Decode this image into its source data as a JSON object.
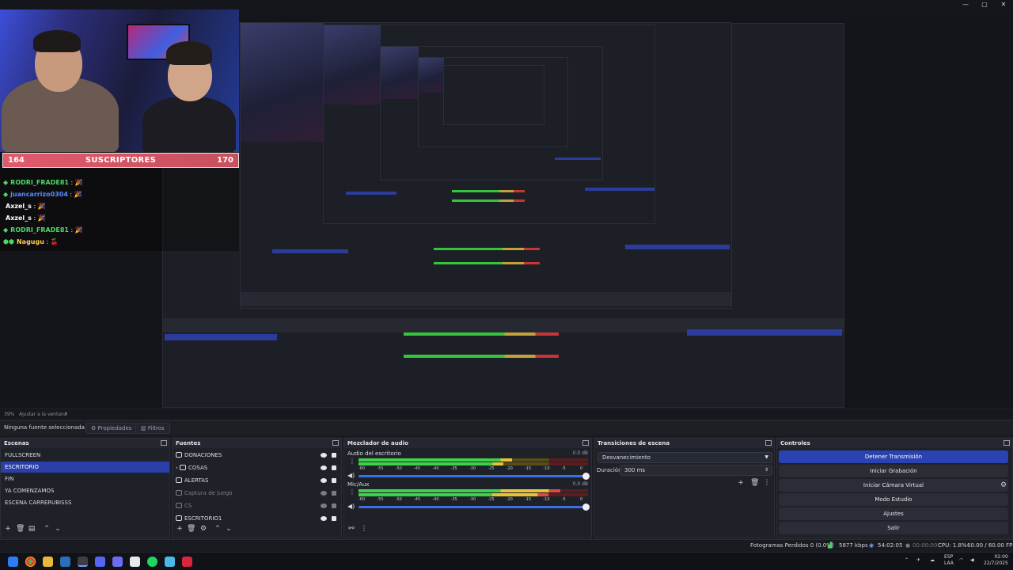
{
  "window": {
    "controls": [
      "—",
      "▢",
      "✕"
    ]
  },
  "overlay": {
    "sub_bar": {
      "current": "164",
      "label": "SUSCRIPTORES",
      "goal": "170"
    },
    "chat": [
      {
        "user": "RODRI_FRADE81",
        "msg": "🎉",
        "color": "#4cd964",
        "badge": "◆"
      },
      {
        "user": "juancarrizo0304",
        "msg": "🎉",
        "color": "#5a8cff",
        "badge": "◆"
      },
      {
        "user": "Axzel_s",
        "msg": "🎉",
        "color": "#ffffff",
        "badge": ""
      },
      {
        "user": "Axzel_s",
        "msg": "🎉",
        "color": "#ffffff",
        "badge": ""
      },
      {
        "user": "RODRI_FRADE81",
        "msg": "🎉",
        "color": "#4cd964",
        "badge": "◆"
      },
      {
        "user": "Nagugu",
        "msg": "🍒",
        "color": "#ffd24a",
        "badge": "⬢⬢"
      }
    ]
  },
  "zoom": {
    "level": "39%",
    "fit": "Ajustar a la ventana"
  },
  "props_row": {
    "no_source": "Ninguna fuente seleccionada",
    "properties": "Propiedades",
    "filters": "Filtros"
  },
  "scenes": {
    "title": "Escenas",
    "items": [
      "FULLSCREEN",
      "ESCRITORIO",
      "FIN",
      "YA COMENZAMOS",
      "ESCENA CARRERUBISSS"
    ],
    "selected": 1
  },
  "sources": {
    "title": "Fuentes",
    "items": [
      {
        "label": "DONACIONES",
        "dim": false
      },
      {
        "label": "COSAS",
        "dim": false
      },
      {
        "label": "ALERTAS",
        "dim": false
      },
      {
        "label": "Captura de juego",
        "dim": true
      },
      {
        "label": "CS",
        "dim": true
      },
      {
        "label": "ESCRITORIO1",
        "dim": false
      }
    ]
  },
  "mixer": {
    "title": "Mezclador de audio",
    "channels": [
      {
        "name": "Audio del escritorio",
        "db": "0.0 dB",
        "level": 0.67
      },
      {
        "name": "Mic/Aux",
        "db": "0.0 dB",
        "level": 0.88
      }
    ],
    "ticks": [
      "-60",
      "-55",
      "-50",
      "-45",
      "-40",
      "-35",
      "-30",
      "-25",
      "-20",
      "-15",
      "-10",
      "-5",
      "0"
    ]
  },
  "transitions": {
    "title": "Transiciones de escena",
    "type": "Desvanecimiento",
    "duration_label": "Duración",
    "duration_value": "300 ms"
  },
  "controls": {
    "title": "Controles",
    "buttons": [
      "Detener Transmisión",
      "Iniciar Grabación",
      "Iniciar Cámara Virtual",
      "Modo Estudio",
      "Ajustes",
      "Salir"
    ]
  },
  "status": {
    "dropped": "Fotogramas Perdidos 0 (0.0%)",
    "bitrate": "5877 kbps",
    "live_time": "54:02:05",
    "rec_time": "00:00:00",
    "cpu": "CPU: 1.8%",
    "fps": "60.00 / 60.00 FPS"
  },
  "taskbar": {
    "lang": "ESP",
    "region": "LAA",
    "time": "02:00",
    "date": "22/7/2025"
  }
}
